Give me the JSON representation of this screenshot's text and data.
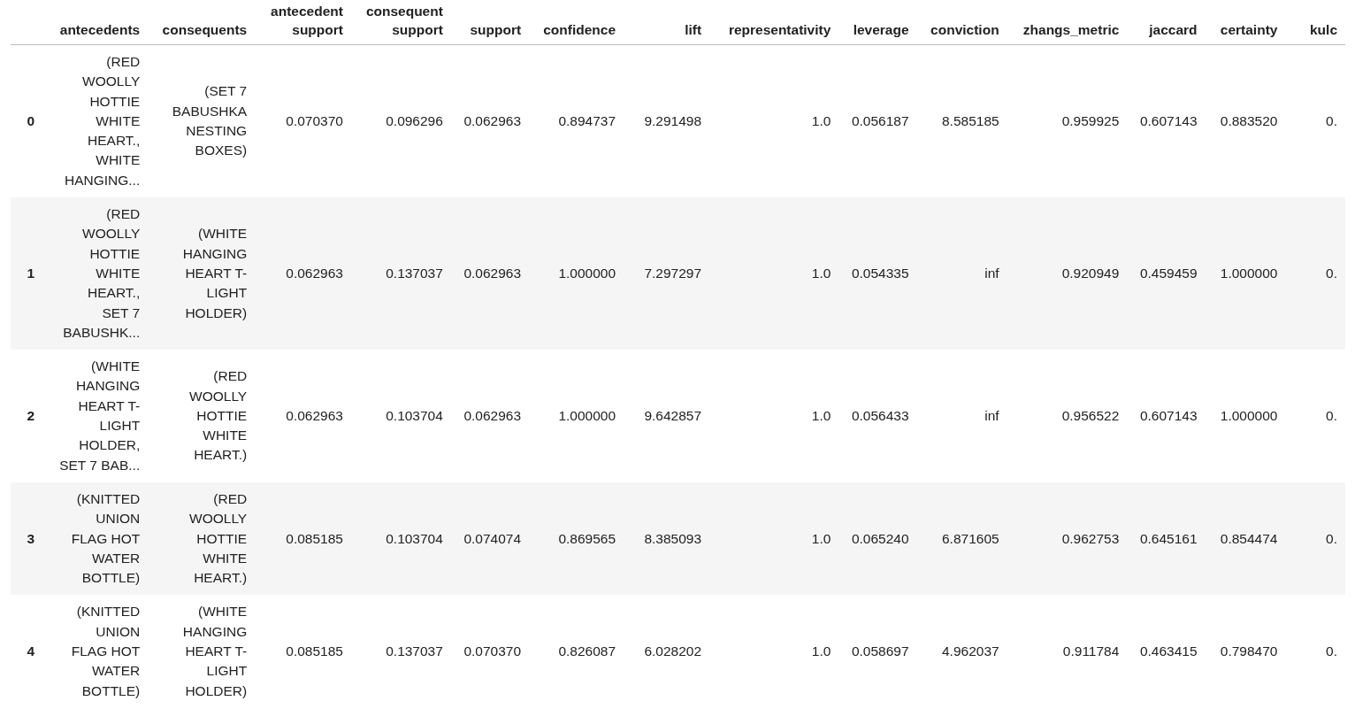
{
  "table": {
    "columns": [
      "",
      "antecedents",
      "consequents",
      "antecedent support",
      "consequent support",
      "support",
      "confidence",
      "lift",
      "representativity",
      "leverage",
      "conviction",
      "zhangs_metric",
      "jaccard",
      "certainty",
      "kulc"
    ],
    "rows": [
      {
        "cells": [
          "0",
          "(RED WOOLLY HOTTIE WHITE HEART., WHITE HANGING...",
          "(SET 7 BABUSHKA NESTING BOXES)",
          "0.070370",
          "0.096296",
          "0.062963",
          "0.894737",
          "9.291498",
          "1.0",
          "0.056187",
          "8.585185",
          "0.959925",
          "0.607143",
          "0.883520",
          "0."
        ]
      },
      {
        "cells": [
          "1",
          "(RED WOOLLY HOTTIE WHITE HEART., SET 7 BABUSHK...",
          "(WHITE HANGING HEART T-LIGHT HOLDER)",
          "0.062963",
          "0.137037",
          "0.062963",
          "1.000000",
          "7.297297",
          "1.0",
          "0.054335",
          "inf",
          "0.920949",
          "0.459459",
          "1.000000",
          "0."
        ]
      },
      {
        "cells": [
          "2",
          "(WHITE HANGING HEART T-LIGHT HOLDER, SET 7 BAB...",
          "(RED WOOLLY HOTTIE WHITE HEART.)",
          "0.062963",
          "0.103704",
          "0.062963",
          "1.000000",
          "9.642857",
          "1.0",
          "0.056433",
          "inf",
          "0.956522",
          "0.607143",
          "1.000000",
          "0."
        ]
      },
      {
        "cells": [
          "3",
          "(KNITTED UNION FLAG HOT WATER BOTTLE)",
          "(RED WOOLLY HOTTIE WHITE HEART.)",
          "0.085185",
          "0.103704",
          "0.074074",
          "0.869565",
          "8.385093",
          "1.0",
          "0.065240",
          "6.871605",
          "0.962753",
          "0.645161",
          "0.854474",
          "0."
        ]
      },
      {
        "cells": [
          "4",
          "(KNITTED UNION FLAG HOT WATER BOTTLE)",
          "(WHITE HANGING HEART T-LIGHT HOLDER)",
          "0.085185",
          "0.137037",
          "0.070370",
          "0.826087",
          "6.028202",
          "1.0",
          "0.058697",
          "4.962037",
          "0.911784",
          "0.463415",
          "0.798470",
          "0."
        ]
      }
    ]
  }
}
